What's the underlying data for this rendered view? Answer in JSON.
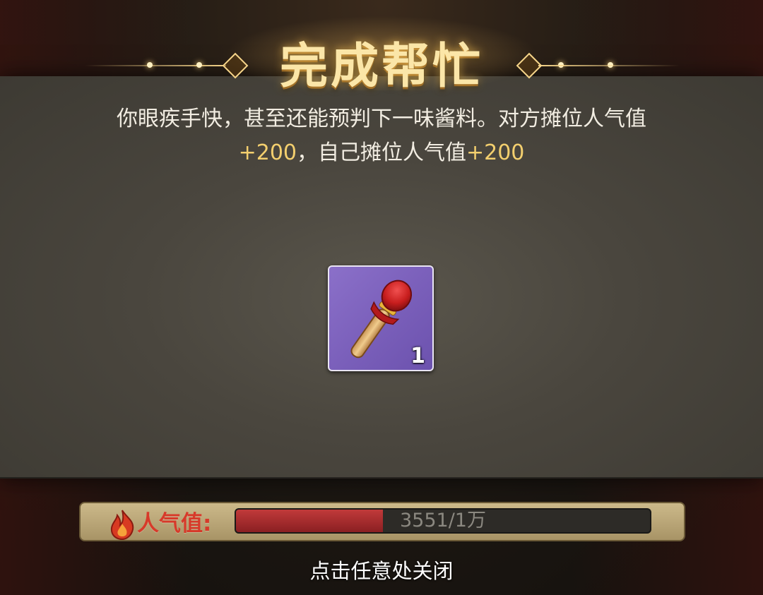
{
  "dialog": {
    "title": "完成帮忙",
    "description": {
      "line1": "你眼疾手快，甚至还能预判下一味酱料。对方摊位人气值",
      "rival_gain": "+200",
      "mid_text": "，自己摊位人气值",
      "self_gain": "+200"
    },
    "reward": {
      "icon": "red-torch-stick-icon",
      "count": "1",
      "slot_color": "#7b60bb"
    }
  },
  "popularity": {
    "label": "人气值:",
    "value_text": "3551/1万",
    "fraction": 0.3551,
    "icon": "flame-icon",
    "fill_color": "#b23030"
  },
  "footer": {
    "close_hint": "点击任意处关闭"
  }
}
